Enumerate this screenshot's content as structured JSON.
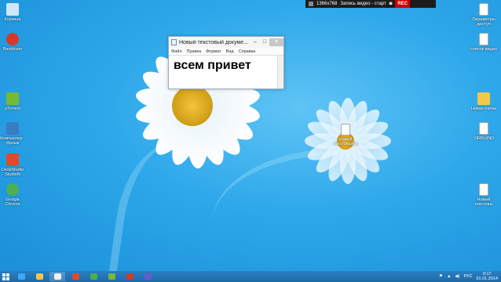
{
  "recorder": {
    "resolution": "1366x768",
    "status": "Запись видео - старт",
    "rec_label": "REC"
  },
  "desktop_icons_left": [
    {
      "label": "Корзина",
      "icon": "recycle-bin-icon",
      "color": "#cfe7f7"
    },
    {
      "label": "Bandicam",
      "icon": "bandicam-icon",
      "color": "#d33a2c"
    },
    {
      "label": "uTorrent",
      "icon": "utorrent-icon",
      "color": "#78b832"
    },
    {
      "label": "Компьютер - Ярлык",
      "icon": "computer-icon",
      "color": "#3a7cc4"
    },
    {
      "label": "DeskStudio StudioN",
      "icon": "app-icon",
      "color": "#e04a2a"
    },
    {
      "label": "Google Chrome",
      "icon": "chrome-icon",
      "color": "#4caf50"
    }
  ],
  "desktop_icons_right": [
    {
      "label": "Параметры доступ",
      "icon": "document-icon",
      "color": "#ffffff"
    },
    {
      "label": "список видео",
      "icon": "document-icon",
      "color": "#ffffff"
    },
    {
      "label": "Новая папка",
      "icon": "folder-icon",
      "color": "#f2c84b"
    },
    {
      "label": "VIRBUIND",
      "icon": "document-icon",
      "color": "#ffffff"
    },
    {
      "label": "Новый текстовы",
      "icon": "document-icon",
      "color": "#ffffff"
    }
  ],
  "desktop_icon_center": {
    "label": "Новый текстовый д",
    "icon": "document-icon"
  },
  "notepad": {
    "title": "Новый текстовый докуме...",
    "minimize": "–",
    "maximize": "□",
    "close": "✕",
    "menu": [
      "Файл",
      "Правка",
      "Формат",
      "Вид",
      "Справка"
    ],
    "content": "всем привет"
  },
  "taskbar": {
    "items": [
      {
        "name": "taskbar-ie",
        "color": "#3fa9f5"
      },
      {
        "name": "taskbar-explorer",
        "color": "#f2c84b"
      },
      {
        "name": "taskbar-notepad",
        "color": "#e9f2fb"
      },
      {
        "name": "taskbar-app",
        "color": "#e04a2a"
      },
      {
        "name": "taskbar-chrome",
        "color": "#4caf50"
      },
      {
        "name": "taskbar-utorrent",
        "color": "#78b832"
      },
      {
        "name": "taskbar-bandicam",
        "color": "#d33a2c"
      },
      {
        "name": "taskbar-app2",
        "color": "#6a5acd"
      }
    ],
    "lang": "РУС",
    "time": "0:17",
    "date": "01.01.2014"
  },
  "colors": {
    "accent": "#1d6aa8",
    "wallpaper": "#2ea8ea"
  }
}
